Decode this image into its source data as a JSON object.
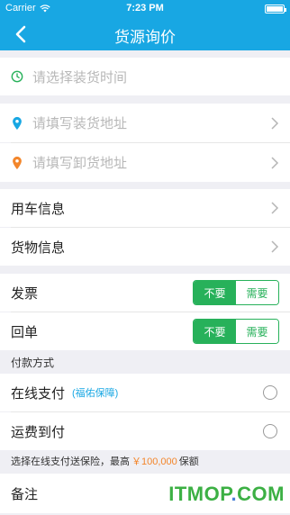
{
  "status_bar": {
    "carrier": "Carrier",
    "time": "7:23 PM"
  },
  "nav": {
    "title": "货源询价"
  },
  "load_time": {
    "placeholder": "请选择装货时间"
  },
  "load_address": {
    "placeholder": "请填写装货地址"
  },
  "unload_address": {
    "placeholder": "请填写卸货地址"
  },
  "vehicle_info": {
    "label": "用车信息"
  },
  "cargo_info": {
    "label": "货物信息"
  },
  "invoice": {
    "label": "发票",
    "no": "不要",
    "yes": "需要",
    "selected": "不要"
  },
  "receipt": {
    "label": "回单",
    "no": "不要",
    "yes": "需要",
    "selected": "不要"
  },
  "payment": {
    "section_label": "付款方式",
    "online_label": "在线支付",
    "online_note": "(福佑保障)",
    "cod_label": "运费到付"
  },
  "insurance_tip": {
    "prefix": "选择在线支付送保险，最高",
    "amount": "￥100,000",
    "suffix": "保额"
  },
  "remark": {
    "label": "备注"
  },
  "watermark": {
    "text_a": "ITMOP",
    "dot": ".",
    "text_b": "COM"
  },
  "colors": {
    "primary": "#18a7e3",
    "green": "#27b15a",
    "orange": "#f3862b"
  }
}
